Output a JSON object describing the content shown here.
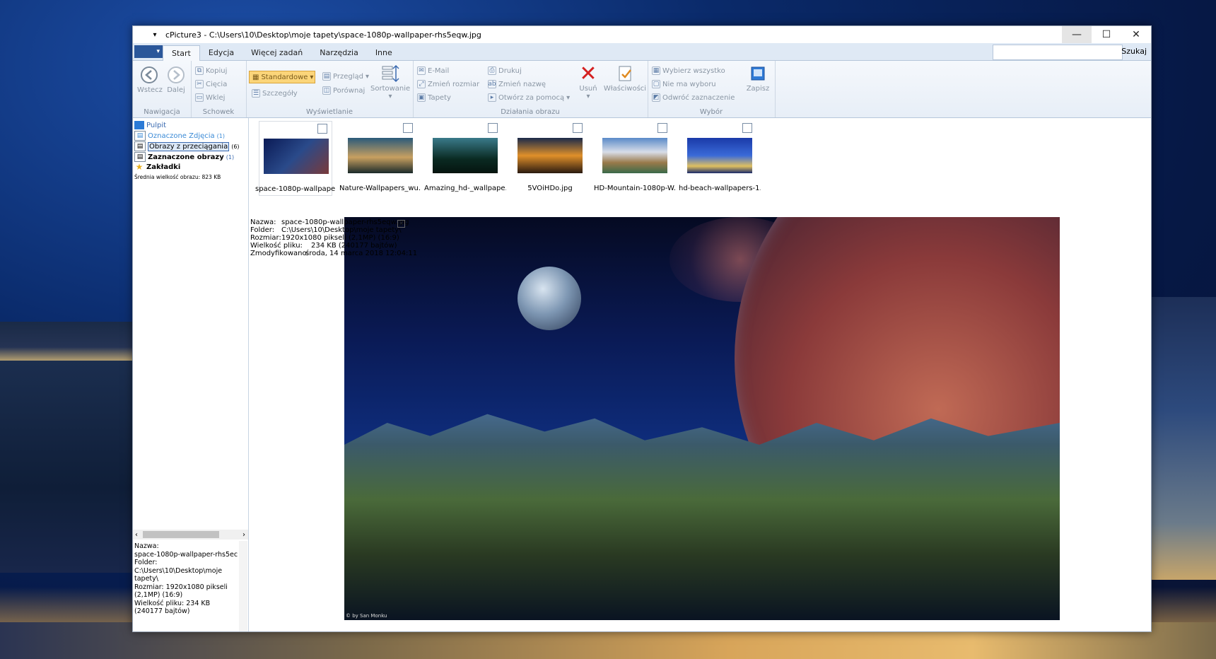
{
  "window": {
    "title": "cPicture3 - C:\\Users\\10\\Desktop\\moje tapety\\space-1080p-wallpaper-rhs5eqw.jpg",
    "controls": {
      "minimize": "—",
      "maximize": "☐",
      "close": "✕"
    }
  },
  "tabs": [
    "Start",
    "Edycja",
    "Więcej zadań",
    "Narzędzia",
    "Inne"
  ],
  "search": {
    "label": "Szukaj",
    "placeholder": ""
  },
  "ribbon": {
    "nav": {
      "back": "Wstecz",
      "forward": "Dalej",
      "group": "Nawigacja"
    },
    "clipboard": {
      "copy": "Kopiuj",
      "cut": "Cięcia",
      "paste": "Wklej",
      "group": "Schowek"
    },
    "view": {
      "standard": "Standardowe",
      "details": "Szczegóły",
      "browse": "Przegląd",
      "compare": "Porównaj",
      "sort": "Sortowanie",
      "group": "Wyświetlanie"
    },
    "actions": {
      "email": "E-Mail",
      "resize": "Zmień rozmiar",
      "wallpaper": "Tapety",
      "print": "Drukuj",
      "rename": "Zmień nazwę",
      "openwith": "Otwórz za pomocą",
      "delete": "Usuń",
      "properties": "Właściwości",
      "group": "Działania obrazu"
    },
    "selection": {
      "selectall": "Wybierz wszystko",
      "none": "Nie ma wyboru",
      "invert": "Odwróć zaznaczenie",
      "save": "Zapisz",
      "group": "Wybór"
    }
  },
  "sidebar": {
    "items": [
      {
        "label": "Pulpit",
        "count": ""
      },
      {
        "label": "Oznaczone Zdjęcia",
        "count": "(1)"
      },
      {
        "label": "Obrazy z przeciągania",
        "count": "(6)"
      },
      {
        "label": "Zaznaczone obrazy",
        "count": "(1)"
      },
      {
        "label": "Zakładki",
        "count": ""
      }
    ],
    "avg_size": "Średnia wielkość obrazu: 823 KB",
    "info_lines": [
      "Nazwa:",
      "space-1080p-wallpaper-rhs5ec",
      "",
      "Folder:",
      "C:\\Users\\10\\Desktop\\moje",
      "tapety\\",
      "Rozmiar: 1920x1080 pikseli",
      "(2,1MP) (16:9)",
      "Wielkość pliku:       234 KB",
      "(240177 bajtów)"
    ]
  },
  "thumbnails": [
    {
      "caption": "space-1080p-wallpape...",
      "c1": "#0a1a55",
      "c2": "#7a3a3a"
    },
    {
      "caption": "Nature-Wallpapers_wu...",
      "c1": "#2a5a7a",
      "c2": "#c8a060"
    },
    {
      "caption": "Amazing_hd-_wallpape...",
      "c1": "#0a2a22",
      "c2": "#3a7a8a"
    },
    {
      "caption": "5VOiHDo.jpg",
      "c1": "#1a2a4a",
      "c2": "#e0902a"
    },
    {
      "caption": "HD-Mountain-1080p-W...",
      "c1": "#5a8ac8",
      "c2": "#9a7a4a"
    },
    {
      "caption": "hd-beach-wallpapers-1...",
      "c1": "#1a3aa8",
      "c2": "#e0c060"
    }
  ],
  "overlay": {
    "rows": [
      {
        "k": "Nazwa:",
        "v": "space-1080p-wallpaper-rhs5eqw.jpg"
      },
      {
        "k": "Folder:",
        "v": "C:\\Users\\10\\Desktop\\moje tapety\\"
      },
      {
        "k": "Rozmiar:",
        "v": "1920x1080 pikseli (2,1MP) (16:9)"
      },
      {
        "k": "Wielkość pliku:",
        "v": "234 KB (240177 bajtów)"
      },
      {
        "k": "Zmodyfikowano:",
        "v": "środa, 14 marca 2018 12:04:11"
      }
    ],
    "close": "✕",
    "credit": "© by San Monku"
  }
}
